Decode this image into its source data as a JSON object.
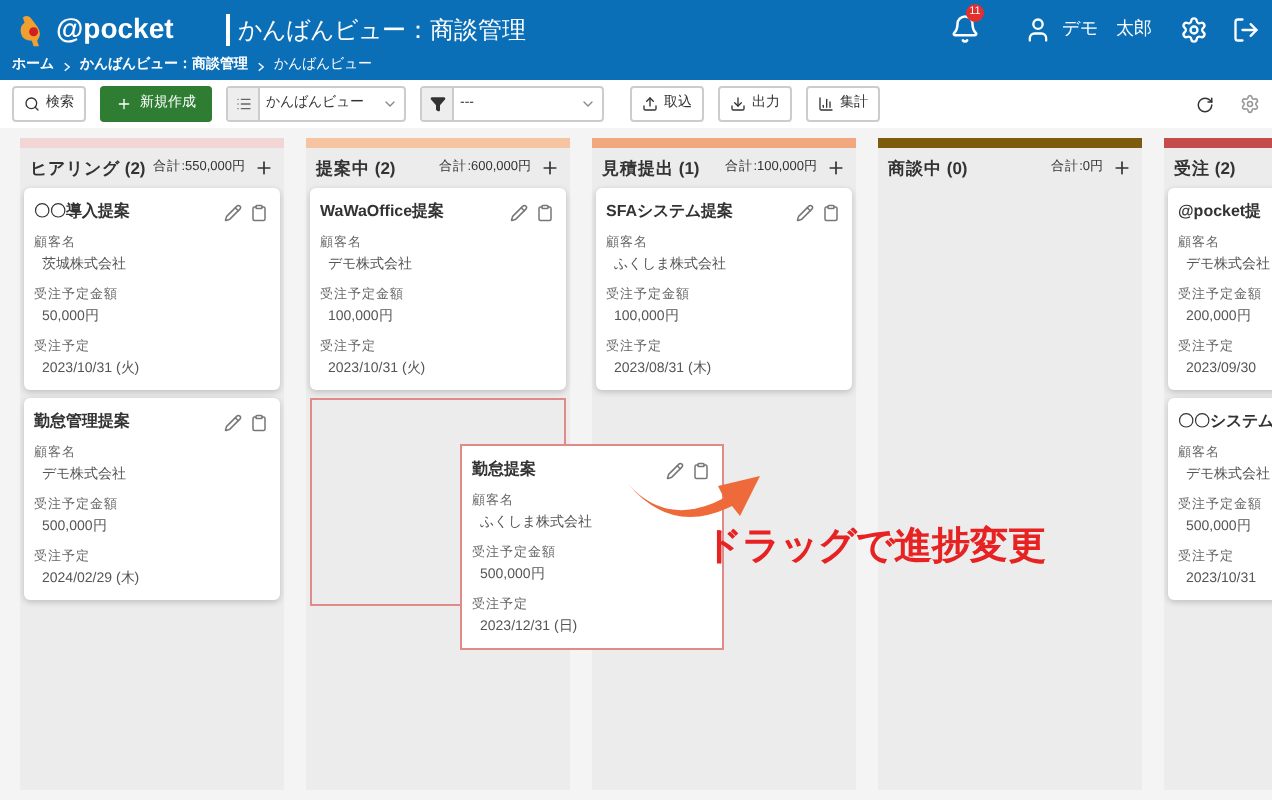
{
  "header": {
    "logo": "@pocket",
    "title": "かんばんビュー：商談管理",
    "notifications": "11",
    "user": "デモ　太郎"
  },
  "breadcrumb": [
    "ホーム",
    "かんばんビュー：商談管理",
    "かんばんビュー"
  ],
  "toolbar": {
    "search": "検索",
    "create": "新規作成",
    "view": "かんばんビュー",
    "filter": "---",
    "import": "取込",
    "export": "出力",
    "summary": "集計"
  },
  "columns": [
    {
      "title": "ヒアリング (2)",
      "total": "合計:550,000円",
      "color": "#f2d6d6",
      "drop_placeholder": false,
      "cards": [
        {
          "title": "〇〇導入提案",
          "fields": [
            {
              "label": "顧客名",
              "value": "茨城株式会社"
            },
            {
              "label": "受注予定金額",
              "value": "50,000円"
            },
            {
              "label": "受注予定",
              "value": "2023/10/31 (火)"
            }
          ]
        },
        {
          "title": "勤怠管理提案",
          "fields": [
            {
              "label": "顧客名",
              "value": "デモ株式会社"
            },
            {
              "label": "受注予定金額",
              "value": "500,000円"
            },
            {
              "label": "受注予定",
              "value": "2024/02/29 (木)"
            }
          ]
        }
      ]
    },
    {
      "title": "提案中 (2)",
      "total": "合計:600,000円",
      "color": "#f6c4a0",
      "drop_placeholder": true,
      "cards": [
        {
          "title": "WaWaOffice提案",
          "fields": [
            {
              "label": "顧客名",
              "value": "デモ株式会社"
            },
            {
              "label": "受注予定金額",
              "value": "100,000円"
            },
            {
              "label": "受注予定",
              "value": "2023/10/31 (火)"
            }
          ]
        }
      ]
    },
    {
      "title": "見積提出 (1)",
      "total": "合計:100,000円",
      "color": "#f2a87e",
      "drop_placeholder": false,
      "cards": [
        {
          "title": "SFAシステム提案",
          "fields": [
            {
              "label": "顧客名",
              "value": "ふくしま株式会社"
            },
            {
              "label": "受注予定金額",
              "value": "100,000円"
            },
            {
              "label": "受注予定",
              "value": "2023/08/31 (木)"
            }
          ]
        }
      ]
    },
    {
      "title": "商談中 (0)",
      "total": "合計:0円",
      "color": "#7d5a0c",
      "drop_placeholder": false
    },
    {
      "title": "受注 (2)",
      "color": "#c44c4c",
      "drop_placeholder": false,
      "cards": [
        {
          "title": "@pocket提",
          "fields": [
            {
              "label": "顧客名",
              "value": "デモ株式会社"
            },
            {
              "label": "受注予定金額",
              "value": "200,000円"
            },
            {
              "label": "受注予定",
              "value": "2023/09/30"
            }
          ]
        },
        {
          "title": "〇〇システム",
          "fields": [
            {
              "label": "顧客名",
              "value": "デモ株式会社"
            },
            {
              "label": "受注予定金額",
              "value": "500,000円"
            },
            {
              "label": "受注予定",
              "value": "2023/10/31"
            }
          ]
        }
      ]
    }
  ],
  "dragged_card": {
    "title": "勤怠提案",
    "fields": [
      {
        "label": "顧客名",
        "value": "ふくしま株式会社"
      },
      {
        "label": "受注予定金額",
        "value": "500,000円"
      },
      {
        "label": "受注予定",
        "value": "2023/12/31 (日)"
      }
    ]
  },
  "annotation": "ドラッグで進捗変更"
}
